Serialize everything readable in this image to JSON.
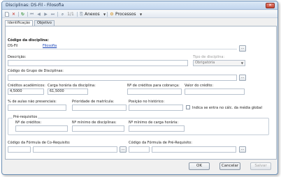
{
  "window": {
    "title": "Disciplinas: DS-Fil - Filosofia",
    "close_label": "✕"
  },
  "toolbar": {
    "page_indicator": "1/1",
    "anexos_label": "Anexos",
    "processos_label": "Processos"
  },
  "tabs": [
    {
      "label": "Identificação",
      "active": true
    },
    {
      "label": "Objetivo",
      "active": false
    }
  ],
  "form": {
    "codigo_label": "Código da disciplina:",
    "codigo_value": "DS-Fil",
    "codigo_name_link": "Filosofia",
    "descricao_label": "Descrição:",
    "descricao_value": "",
    "tipo_label": "Tipo de disciplina:",
    "tipo_value": "Obrigatória",
    "grupo_label": "Código do Grupo de Disciplinas:",
    "grupo_value": "",
    "creditos_label": "Créditos acadêmicos:",
    "creditos_value": "4,5000",
    "carga_label": "Carga horária da disciplina:",
    "carga_value": "61,5000",
    "creditos_cobranca_label": "Nº de créditos para cobrança:",
    "creditos_cobranca_value": "",
    "valor_credito_label": "Valor do crédito:",
    "valor_credito_value": "",
    "aulas_label": "% de aulas não presenciais:",
    "aulas_value": "",
    "prioridade_label": "Prioridade de matrícula:",
    "prioridade_value": "",
    "posicao_label": "Posição no histórico:",
    "posicao_value": "",
    "indica_label": "Indica se entra no cálc. da média global",
    "prereq_group_label": "Pré-requisitos",
    "num_creditos_label": "Nº de créditos:",
    "num_creditos_value": "",
    "num_min_disc_label": "Nº mínimo de disciplinas:",
    "num_min_disc_value": "",
    "num_min_carga_label": "Nº mínimo de carga horária:",
    "num_min_carga_value": "",
    "formula_co_label": "Código da Fórmula de Co-Requisito:",
    "formula_co_value": "",
    "formula_pre_label": "Código da Fórmula de Pré-Requisito:",
    "formula_pre_value": ""
  },
  "footer": {
    "ok_label": "OK",
    "cancel_label": "Cancelar",
    "save_label": "Salvar"
  }
}
